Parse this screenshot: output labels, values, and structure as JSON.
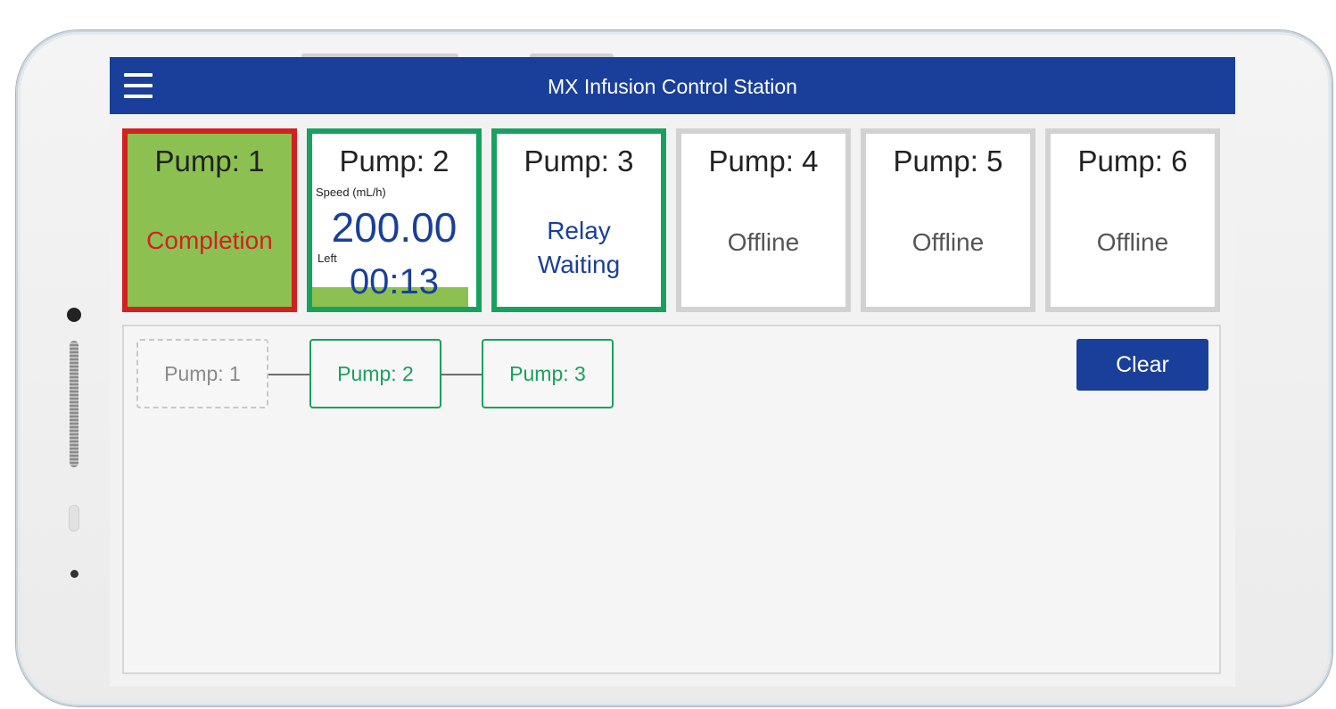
{
  "app": {
    "title": "MX Infusion Control Station"
  },
  "pumps": [
    {
      "title": "Pump: 1",
      "status": "Completion",
      "state": "completion"
    },
    {
      "title": "Pump: 2",
      "state": "running",
      "speed_label": "Speed  (mL/h)",
      "speed_value": "200.00",
      "left_label": "Left",
      "left_value": "00:13",
      "progress_fraction": 0.95
    },
    {
      "title": "Pump: 3",
      "status_line1": "Relay",
      "status_line2": "Waiting",
      "state": "relay"
    },
    {
      "title": "Pump: 4",
      "status": "Offline",
      "state": "offline"
    },
    {
      "title": "Pump: 5",
      "status": "Offline",
      "state": "offline"
    },
    {
      "title": "Pump: 6",
      "status": "Offline",
      "state": "offline"
    }
  ],
  "relay": {
    "nodes": [
      {
        "label": "Pump: 1",
        "state": "inactive"
      },
      {
        "label": "Pump: 2",
        "state": "active"
      },
      {
        "label": "Pump: 3",
        "state": "active"
      }
    ],
    "clear_label": "Clear"
  },
  "colors": {
    "appbar": "#1a3f9a",
    "active_green": "#18a15e",
    "completion_fill": "#8cc152",
    "completion_border": "#d32020",
    "offline_border": "#d2d2d2"
  },
  "icons": {
    "menu": "hamburger-menu-icon"
  }
}
